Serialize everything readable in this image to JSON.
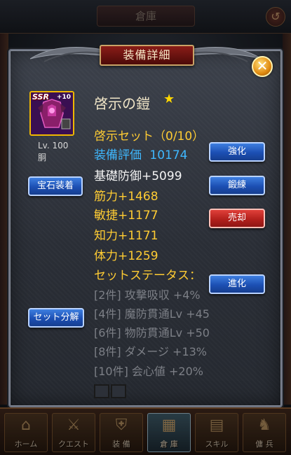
{
  "background": {
    "screen_title": "倉庫",
    "back_icon": "back-arrow-icon"
  },
  "modal": {
    "title": "装備詳細",
    "close_icon": "close-x-icon",
    "item": {
      "rarity": "SSR",
      "plus": "+10",
      "level": "Lv. 100",
      "slot": "胴",
      "name": "啓示の鎧",
      "star_icon": "star-icon"
    },
    "stats": {
      "set_name": "啓示セット（0/10）",
      "rating_label": "装備評価",
      "rating_value": "10174",
      "base_defense": "基礎防御+5099",
      "strength": "筋力+1468",
      "agility": "敏捷+1177",
      "intellect": "知力+1171",
      "stamina": "体力+1259",
      "set_status_header": "セットステータス："
    },
    "set_bonuses": [
      "[2件] 攻撃吸収 +4%",
      "[4件] 魔防貫通Lv +45",
      "[6件] 物防貫通Lv +50",
      "[8件] ダメージ +13%",
      "[10件] 会心値 +20%"
    ],
    "buttons": {
      "gem_equip": "宝石装着",
      "set_split": "セット分解",
      "enhance": "強化",
      "train": "鍛練",
      "sell": "売却",
      "evolve": "進化"
    }
  },
  "bottom_nav": [
    {
      "label": "ホーム",
      "icon": "home-icon"
    },
    {
      "label": "クエスト",
      "icon": "crossed-swords-icon"
    },
    {
      "label": "装 備",
      "icon": "armor-icon"
    },
    {
      "label": "倉 庫",
      "icon": "warehouse-icon",
      "active": true
    },
    {
      "label": "スキル",
      "icon": "scroll-icon"
    },
    {
      "label": "傭 兵",
      "icon": "mercenary-icon"
    }
  ],
  "colors": {
    "gold_text": "#ffcc33",
    "blue_text": "#3fb8ff",
    "grey_text": "#7c7f86",
    "title_plate": "#8a1d18",
    "blue_button": "#1c4fb3",
    "red_button": "#b3201c"
  }
}
